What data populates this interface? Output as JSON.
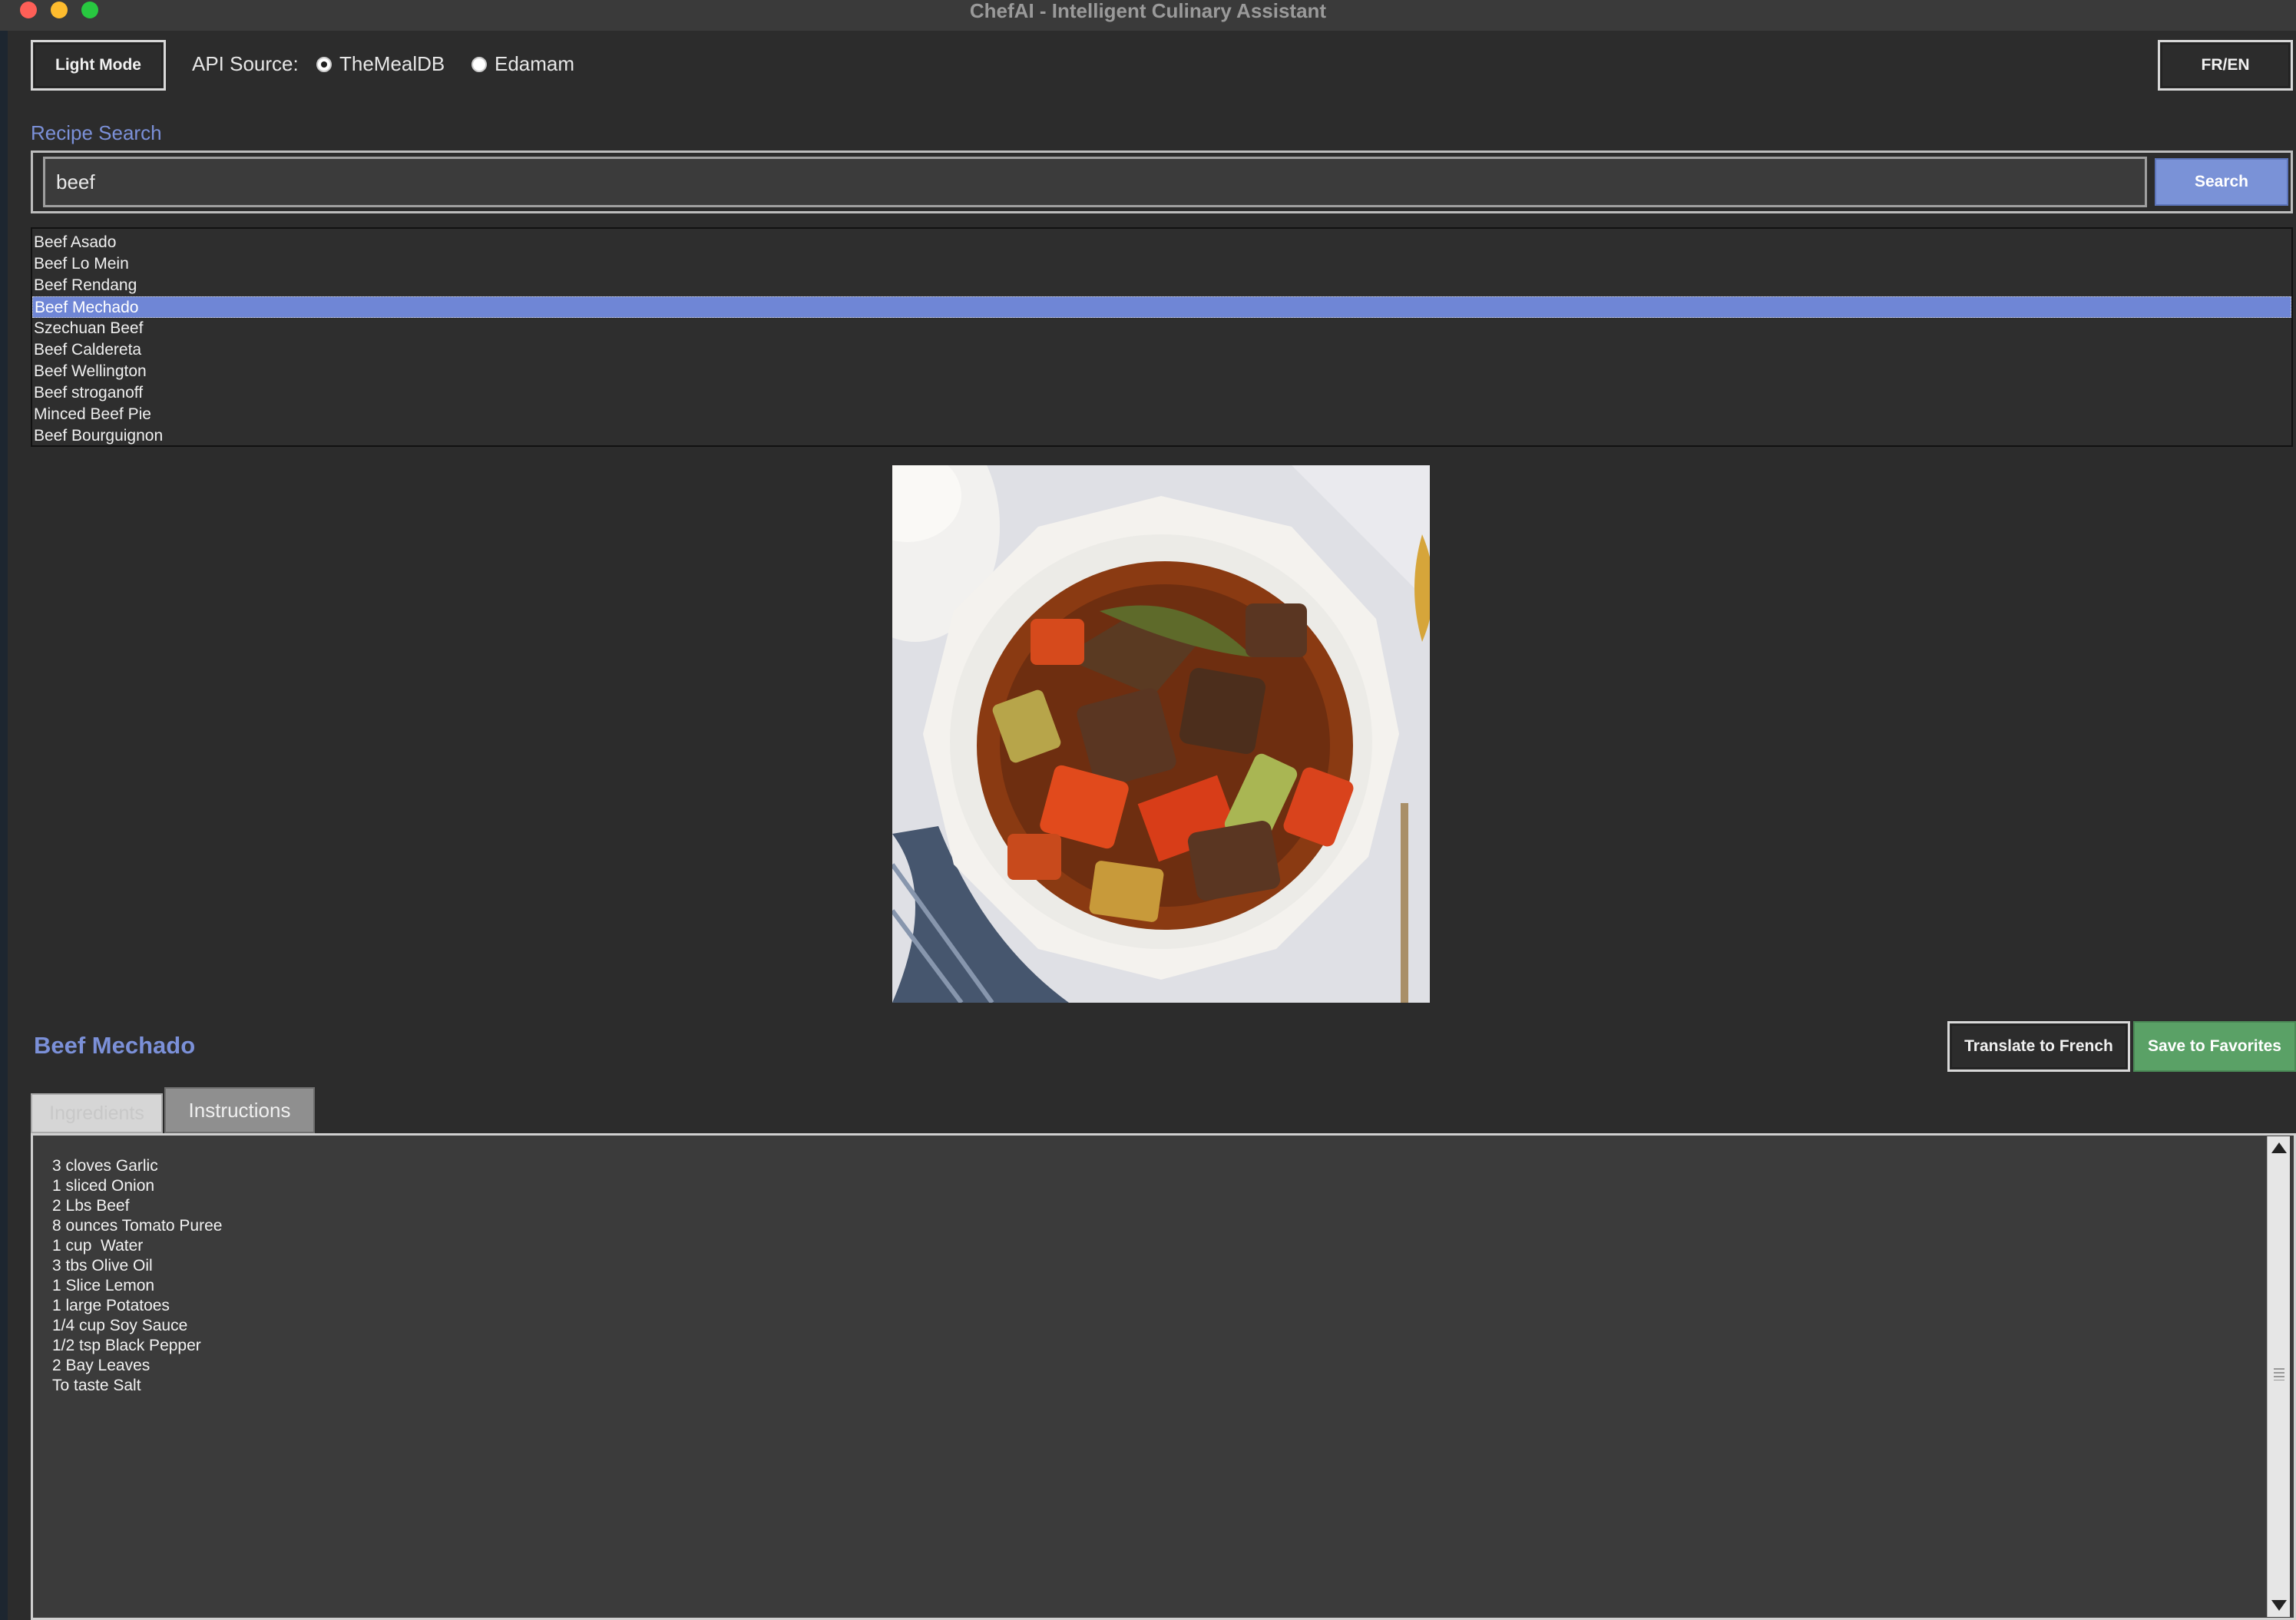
{
  "window": {
    "title": "ChefAI - Intelligent Culinary Assistant"
  },
  "toolbar": {
    "theme_button": "Light Mode",
    "api_source_label": "API Source:",
    "api_options": [
      {
        "label": "TheMealDB",
        "selected": true
      },
      {
        "label": "Edamam",
        "selected": false
      }
    ],
    "language_button": "FR/EN"
  },
  "search": {
    "section_label": "Recipe Search",
    "query": "beef",
    "button": "Search"
  },
  "results": {
    "items": [
      "Beef Asado",
      "Beef Lo Mein",
      "Beef Rendang",
      "Beef Mechado",
      "Szechuan Beef",
      "Beef Caldereta",
      "Beef Wellington",
      "Beef stroganoff",
      "Minced Beef Pie",
      "Beef Bourguignon"
    ],
    "selected_index": 3
  },
  "recipe": {
    "title": "Beef Mechado",
    "translate_button": "Translate to French",
    "favorites_button": "Save to Favorites",
    "tabs": [
      "Ingredients",
      "Instructions"
    ],
    "active_tab": "Ingredients",
    "ingredients": [
      "3 cloves Garlic",
      "1 sliced Onion",
      "2 Lbs Beef",
      "8 ounces Tomato Puree",
      "1 cup  Water",
      "3 tbs Olive Oil",
      "1 Slice Lemon",
      "1 large Potatoes",
      "1/4 cup Soy Sauce",
      "1/2 tsp Black Pepper",
      "2 Bay Leaves",
      "To taste Salt"
    ]
  },
  "colors": {
    "accent": "#7b90d8",
    "save": "#5aa166",
    "selection": "#6f86d6",
    "background": "#2c2c2c"
  }
}
